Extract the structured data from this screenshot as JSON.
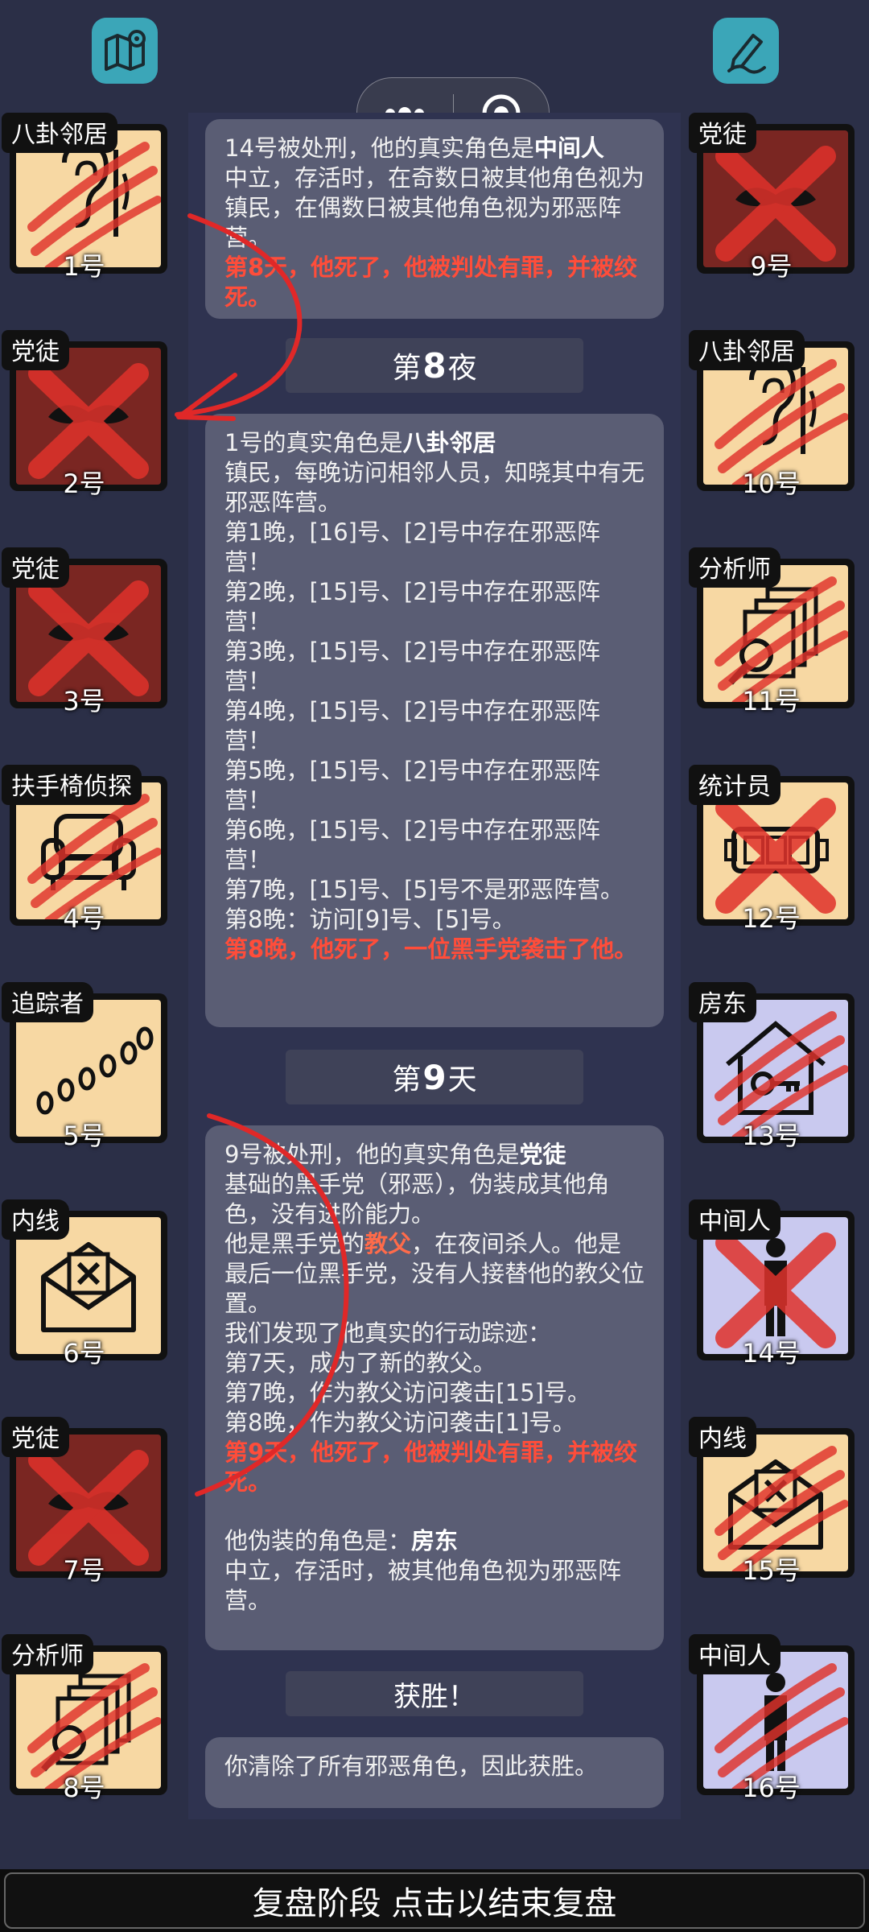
{
  "top_left_icon": "map-pin-icon",
  "top_right_icon": "edit-pen-icon",
  "capsule": {
    "more_icon": "more-dots-icon",
    "close_icon": "target-close-icon"
  },
  "colors": {
    "accent_red": "#ff4d3a",
    "tile_beige": "#f7d8a3",
    "tile_lavender": "#c9c9ef",
    "tile_maroon": "#7a2622"
  },
  "players_left": [
    {
      "role": "八卦邻居",
      "number": "1号",
      "icon": "ear-icon",
      "bg": "beige",
      "status": "scratched"
    },
    {
      "role": "党徒",
      "number": "2号",
      "icon": "mustache-icon",
      "bg": "maroon",
      "status": "crossed"
    },
    {
      "role": "党徒",
      "number": "3号",
      "icon": "mustache-icon",
      "bg": "maroon",
      "status": "crossed"
    },
    {
      "role": "扶手椅侦探",
      "number": "4号",
      "icon": "armchair-icon",
      "bg": "beige",
      "status": "scratched"
    },
    {
      "role": "追踪者",
      "number": "5号",
      "icon": "footprints-icon",
      "bg": "beige",
      "status": "alive"
    },
    {
      "role": "内线",
      "number": "6号",
      "icon": "envelope-x-icon",
      "bg": "beige",
      "status": "alive"
    },
    {
      "role": "党徒",
      "number": "7号",
      "icon": "mustache-icon",
      "bg": "maroon",
      "status": "crossed"
    },
    {
      "role": "分析师",
      "number": "8号",
      "icon": "documents-magnifier-icon",
      "bg": "beige",
      "status": "scratched"
    }
  ],
  "players_right": [
    {
      "role": "党徒",
      "number": "9号",
      "icon": "mustache-icon",
      "bg": "maroon",
      "status": "crossed"
    },
    {
      "role": "八卦邻居",
      "number": "10号",
      "icon": "ear-icon",
      "bg": "beige",
      "status": "scratched"
    },
    {
      "role": "分析师",
      "number": "11号",
      "icon": "documents-magnifier-icon",
      "bg": "beige",
      "status": "scratched"
    },
    {
      "role": "统计员",
      "number": "12号",
      "icon": "counter-icon",
      "bg": "beige",
      "status": "crossed"
    },
    {
      "role": "房东",
      "number": "13号",
      "icon": "house-key-icon",
      "bg": "lavender",
      "status": "scratched"
    },
    {
      "role": "中间人",
      "number": "14号",
      "icon": "person-icon",
      "bg": "lavender",
      "status": "crossed"
    },
    {
      "role": "内线",
      "number": "15号",
      "icon": "envelope-x-icon",
      "bg": "beige",
      "status": "scratched"
    },
    {
      "role": "中间人",
      "number": "16号",
      "icon": "person-icon",
      "bg": "lavender",
      "status": "scratched"
    }
  ],
  "log": {
    "card1": {
      "line1_pre": "14号被处刑，他的真实角色是",
      "line1_role": "中间人",
      "desc": "中立，存活时，在奇数日被其他角色视为镇民，在偶数日被其他角色视为邪恶阵营。",
      "death": "第8天，他死了，他被判处有罪，并被绞死。"
    },
    "phase1": {
      "pre": "第",
      "num": "8",
      "post": "夜"
    },
    "card2": {
      "line1_pre": "1号的真实角色是",
      "line1_role": "八卦邻居",
      "lines": [
        "镇民，每晚访问相邻人员，知晓其中有无邪恶阵营。",
        "第1晚，[16]号、[2]号中存在邪恶阵营！",
        "第2晚，[15]号、[2]号中存在邪恶阵营！",
        "第3晚，[15]号、[2]号中存在邪恶阵营！",
        "第4晚，[15]号、[2]号中存在邪恶阵营！",
        "第5晚，[15]号、[2]号中存在邪恶阵营！",
        "第6晚，[15]号、[2]号中存在邪恶阵营！",
        "第7晚，[15]号、[5]号不是邪恶阵营。",
        "第8晚：访问[9]号、[5]号。"
      ],
      "death": "第8晚，他死了，一位黑手党袭击了他。"
    },
    "phase2": {
      "pre": "第",
      "num": "9",
      "post": "天"
    },
    "card3": {
      "line1_pre": "9号被处刑，他的真实角色是",
      "line1_role": "党徒",
      "desc": "基础的黑手党（邪恶），伪装成其他角色，没有进阶能力。",
      "godfather_pre": "他是黑手党的",
      "godfather_role": "教父",
      "godfather_post": "，在夜间杀人。他是最后一位黑手党，没有人接替他的教父位置。",
      "lines": [
        "我们发现了他真实的行动踪迹：",
        "第7天，成为了新的教父。",
        "第7晚，作为教父访问袭击[15]号。",
        "第8晚，作为教父访问袭击[1]号。"
      ],
      "death": "第9天，他死了，他被判处有罪，并被绞死。",
      "disguise_pre": "他伪装的角色是：",
      "disguise_role": "房东",
      "disguise_desc": "中立，存活时，被其他角色视为邪恶阵营。"
    },
    "phase3": {
      "label": "获胜！"
    },
    "card4": {
      "text": "你清除了所有邪恶角色，因此获胜。"
    }
  },
  "bottom_bar": {
    "label": "复盘阶段 点击以结束复盘"
  }
}
